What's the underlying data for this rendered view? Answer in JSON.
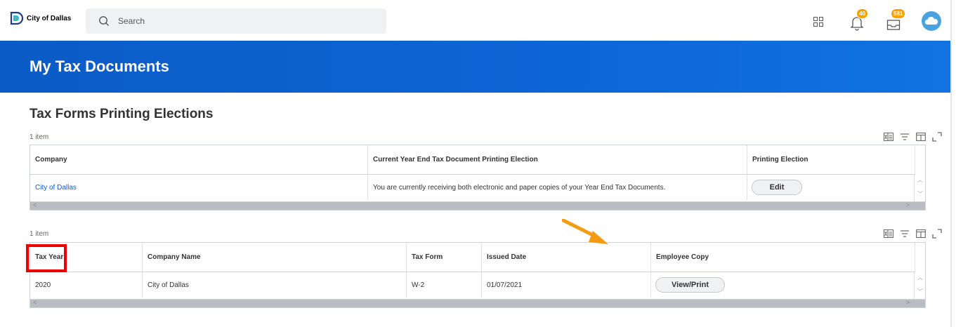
{
  "app": {
    "logo_text": "City of Dallas",
    "search_placeholder": "Search",
    "notifications_count": "40",
    "inbox_count": "581",
    "brand_color": "#0b5bc6",
    "badge_color": "#f4a300"
  },
  "page": {
    "title": "My Tax Documents",
    "section_title": "Tax Forms Printing Elections"
  },
  "elections_table": {
    "item_count": "1 item",
    "columns": [
      "Company",
      "Current Year End Tax Document Printing Election",
      "Printing Election"
    ],
    "rows": [
      {
        "company": "City of Dallas",
        "election": "You are currently receiving both electronic and paper copies of your Year End Tax Documents.",
        "action_label": "Edit"
      }
    ]
  },
  "documents_table": {
    "item_count": "1 item",
    "columns": [
      "Tax Year",
      "Company Name",
      "Tax Form",
      "Issued Date",
      "Employee Copy"
    ],
    "rows": [
      {
        "tax_year": "2020",
        "company_name": "City of Dallas",
        "tax_form": "W-2",
        "issued_date": "01/07/2021",
        "action_label": "View/Print"
      }
    ]
  },
  "toolbar_icons": [
    "export-excel-icon",
    "filter-icon",
    "columns-icon",
    "fullscreen-icon"
  ],
  "annotations": {
    "highlight_color": "#ee0000",
    "arrow_color": "#f39c12"
  }
}
